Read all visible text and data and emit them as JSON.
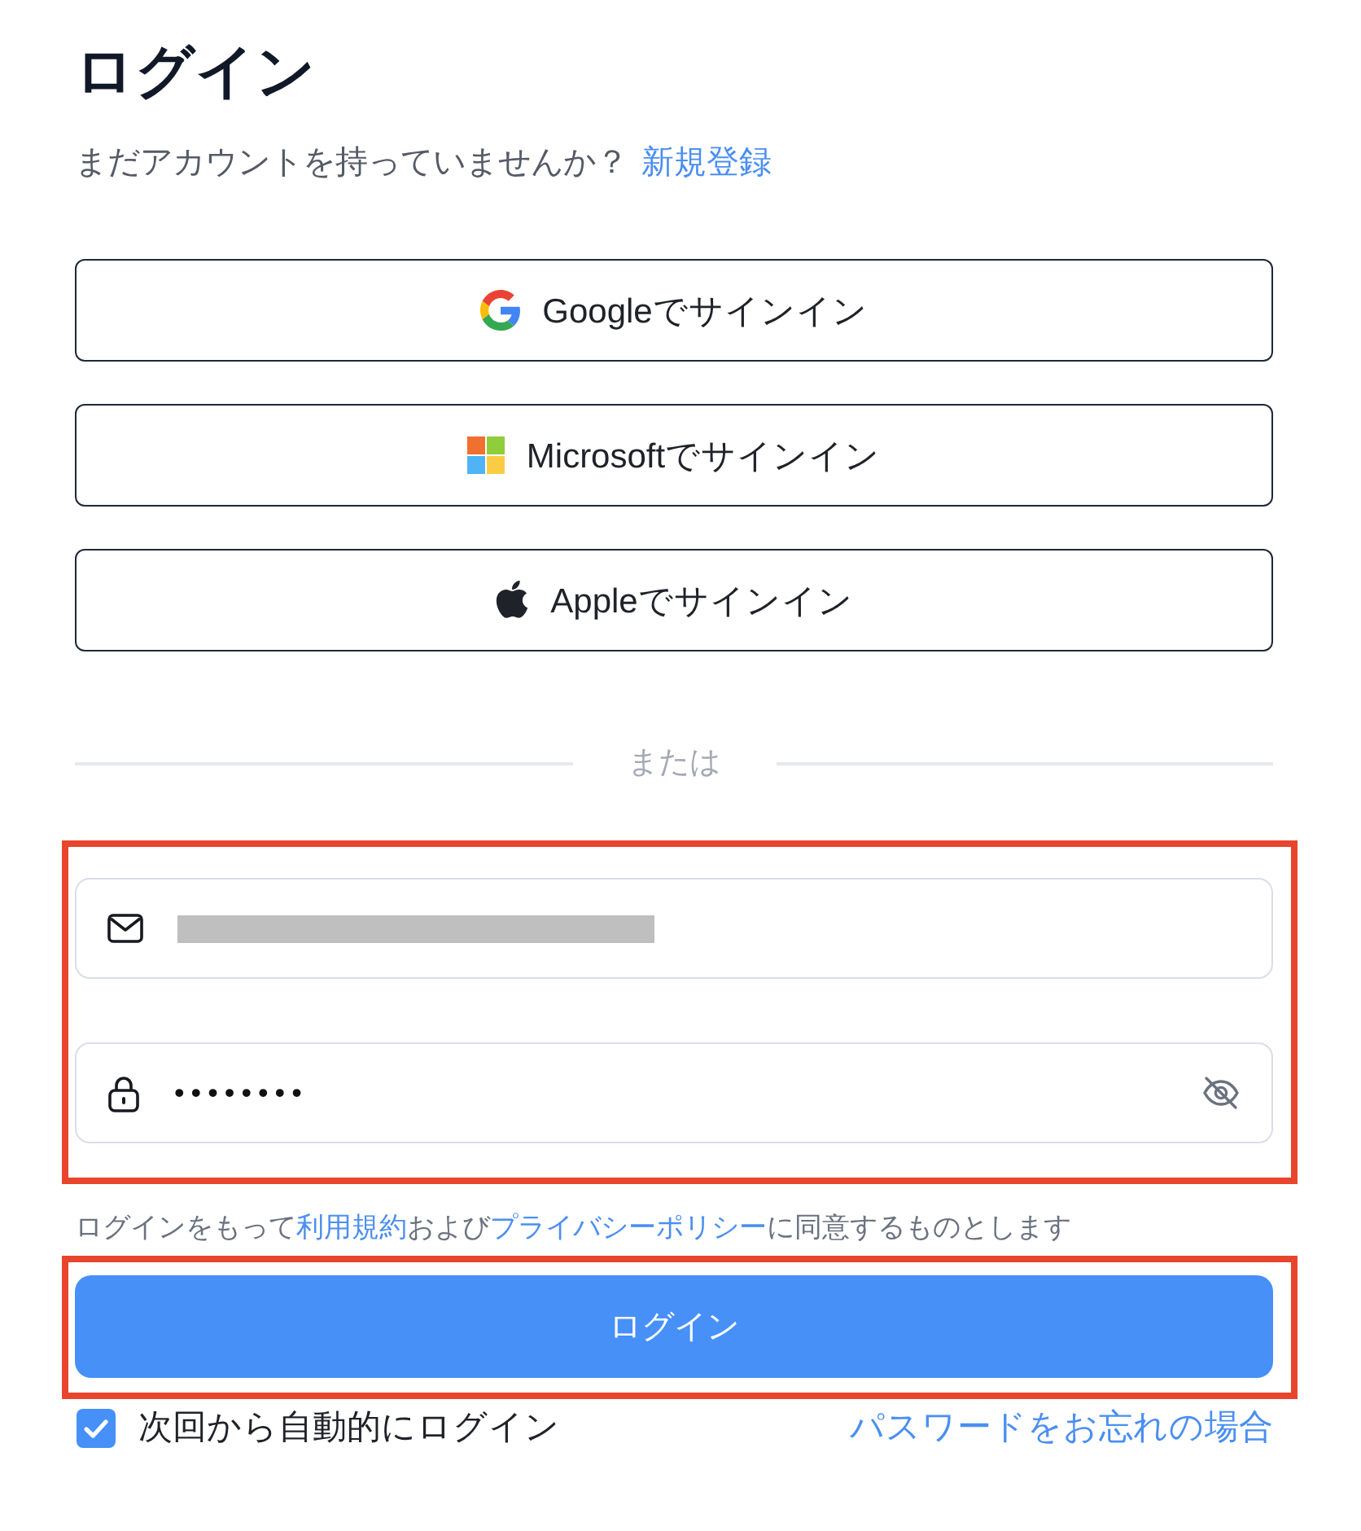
{
  "title": "ログイン",
  "signup": {
    "prompt": "まだアカウントを持っていませんか？",
    "link": "新規登録"
  },
  "social_buttons": [
    {
      "kind": "google",
      "label": "Googleでサインイン"
    },
    {
      "kind": "microsoft",
      "label": "Microsoftでサインイン"
    },
    {
      "kind": "apple",
      "label": "Appleでサインイン"
    }
  ],
  "divider": {
    "label": "または"
  },
  "credentials": {
    "highlighted": true,
    "fields": [
      {
        "kind": "email",
        "value_redacted": true
      },
      {
        "kind": "password",
        "value": "••••••••",
        "revealed": false
      }
    ]
  },
  "terms": [
    {
      "kind": "text",
      "text": "ログインをもって"
    },
    {
      "kind": "link",
      "text": "利用規約"
    },
    {
      "kind": "text",
      "text": "および"
    },
    {
      "kind": "link",
      "text": "プライバシーポリシー"
    },
    {
      "kind": "text",
      "text": "に同意するものとします"
    }
  ],
  "login_button": {
    "label": "ログイン",
    "highlighted": true
  },
  "remember_me": {
    "label": "次回から自動的にログイン",
    "checked": true
  },
  "forgot_password": {
    "label": "パスワードをお忘れの場合"
  }
}
